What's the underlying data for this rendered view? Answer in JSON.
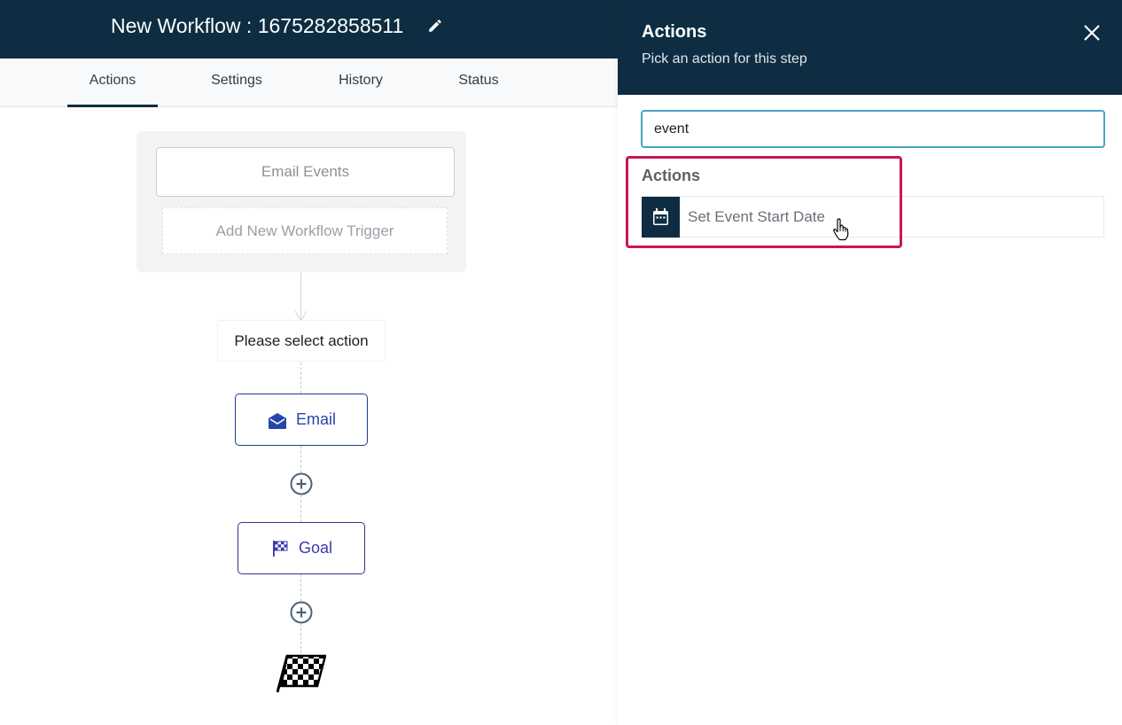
{
  "header": {
    "title": "New Workflow : 1675282858511",
    "edit_icon": "pencil-icon"
  },
  "tabs": [
    {
      "label": "Actions",
      "active": true
    },
    {
      "label": "Settings",
      "active": false
    },
    {
      "label": "History",
      "active": false
    },
    {
      "label": "Status",
      "active": false
    }
  ],
  "workflow": {
    "trigger": {
      "label": "Email Events"
    },
    "add_trigger_label": "Add New Workflow Trigger",
    "select_action_label": "Please select action",
    "steps": [
      {
        "label": "Email",
        "icon": "envelope-open-icon",
        "color": "#2846a6"
      },
      {
        "label": "Goal",
        "icon": "checkered-flag-icon",
        "color": "#3d3aa8"
      }
    ],
    "add_step_icon": "plus-circle-icon",
    "end_icon": "finish-flag-icon"
  },
  "drawer": {
    "title": "Actions",
    "subtitle": "Pick an action for this step",
    "close_icon": "close-icon",
    "search": {
      "value": "event",
      "placeholder": ""
    },
    "results_heading": "Actions",
    "results": [
      {
        "label": "Set Event Start Date",
        "icon": "calendar-icon"
      }
    ]
  },
  "colors": {
    "header_bg": "#0e2d42",
    "accent_highlight": "#c8175a",
    "search_border": "#4aa3c8"
  }
}
